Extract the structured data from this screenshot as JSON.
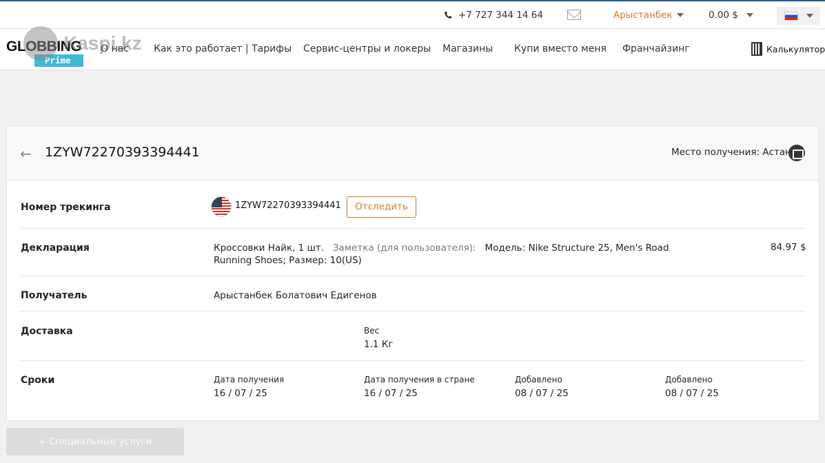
{
  "topbar": {
    "phone": "+7 727 344 14 64",
    "user_name": "Арыстанбек",
    "balance": "0.00 $",
    "phone_icon": "phone-icon",
    "mail_icon": "mail-icon",
    "language_flag": "russia-flag-icon"
  },
  "nav": {
    "logo_text": "GLOBBING",
    "logo_badge": "Prime",
    "watermark_text": "Kaspi.kz",
    "items": [
      "О нас",
      "Как это работает | Тарифы",
      "Сервис-центры и локеры",
      "Магазины",
      "Купи вместо меня",
      "Франчайзинг"
    ],
    "calculator_label": "Калькулятор"
  },
  "parcel": {
    "title": "1ZYW72270393394441",
    "pickup_label": "Место получения: Астана",
    "tracking_label": "Номер трекинга",
    "tracking_number": "1ZYW72270393394441",
    "track_button": "Отследить",
    "declaration_label": "Декларация",
    "declaration_item": "Кроссовки Найк, 1 шт.",
    "declaration_note_label": "Заметка (для пользователя):",
    "declaration_note_text": "Модель: Nike Structure 25, Men's Road Running Shoes; Размер: 10(US)",
    "declaration_price": "84.97 $",
    "recipient_label": "Получатель",
    "recipient_name": "Арыстанбек Болатович Едигенов",
    "delivery_label": "Доставка",
    "weight_label": "Вес",
    "weight_value": "1.1 Кг",
    "dates_label": "Сроки",
    "dates": [
      {
        "label": "Дата получения",
        "value": "16 / 07 / 25"
      },
      {
        "label": "Дата получения в стране",
        "value": "16 / 07 / 25"
      },
      {
        "label": "Добавлено",
        "value": "08 / 07 / 25"
      },
      {
        "label": "Добавлено",
        "value": "08 / 07 / 25"
      }
    ]
  },
  "special_services_button": "+ Специальные услуги",
  "colors": {
    "accent": "#d07a28",
    "badge": "#3dbad6",
    "top_border": "#1d5d8f"
  }
}
